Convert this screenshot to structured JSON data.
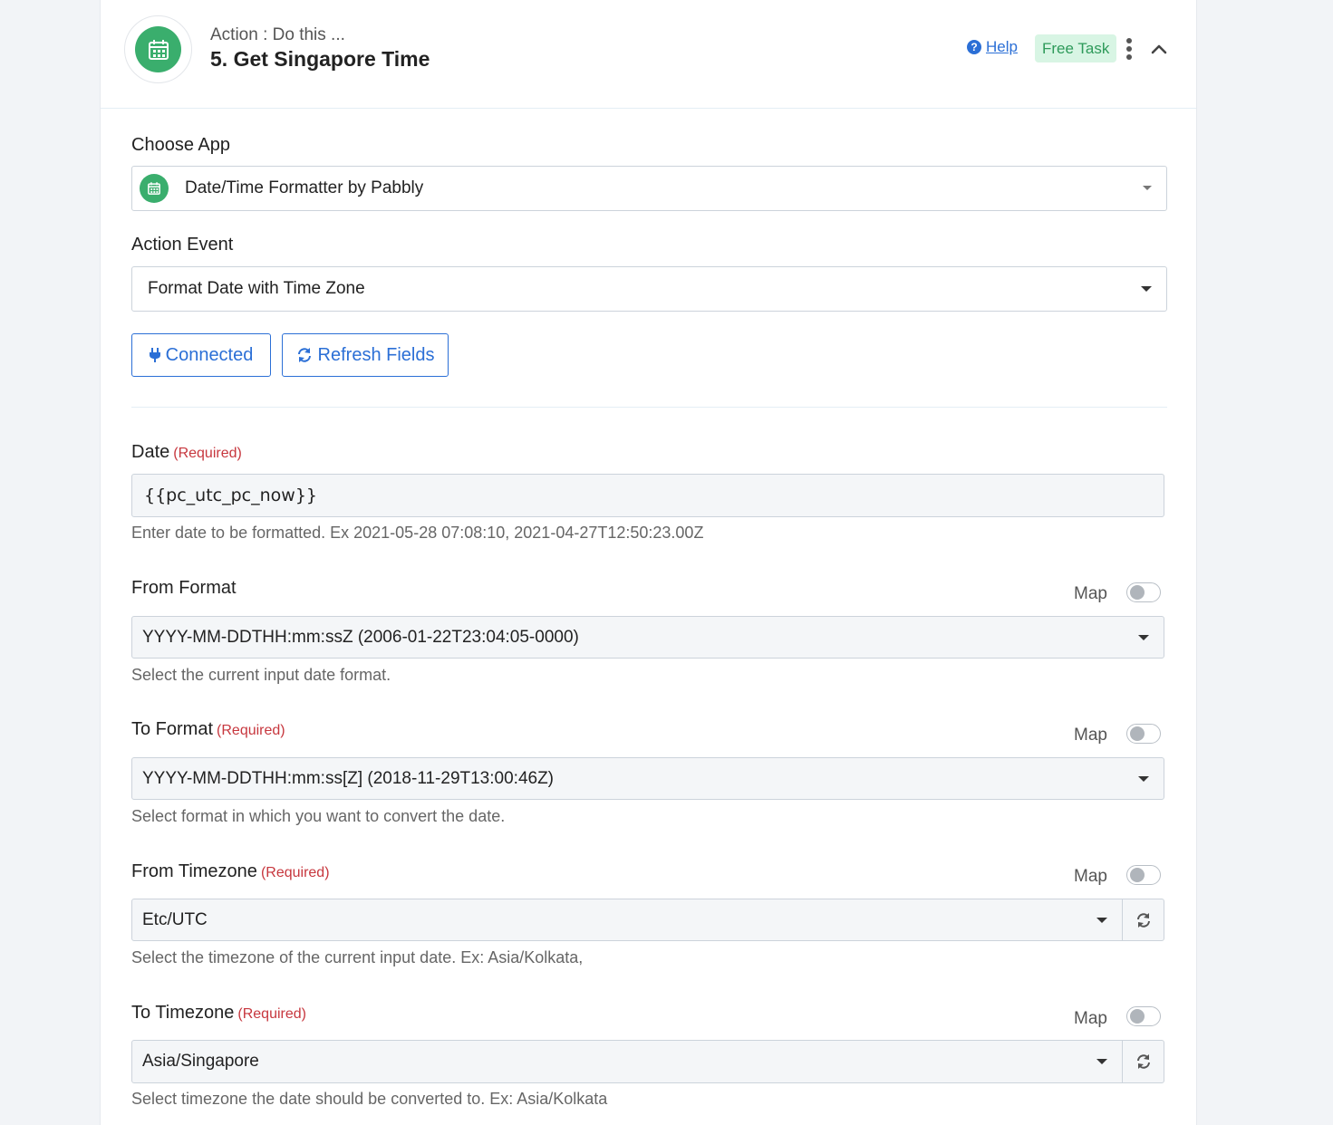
{
  "header": {
    "subtitle": "Action : Do this ...",
    "title": "5. Get Singapore Time",
    "help_label": "Help",
    "free_task_label": "Free Task"
  },
  "choose_app": {
    "label": "Choose App",
    "value": "Date/Time Formatter by Pabbly"
  },
  "action_event": {
    "label": "Action Event",
    "value": "Format Date with Time Zone"
  },
  "buttons": {
    "connected": "Connected",
    "refresh_fields": "Refresh Fields"
  },
  "fields": {
    "date": {
      "label": "Date",
      "required": "(Required)",
      "value": "{{pc_utc_pc_now}}",
      "hint": "Enter date to be formatted. Ex 2021-05-28 07:08:10, 2021-04-27T12:50:23.00Z"
    },
    "from_format": {
      "label": "From Format",
      "map_label": "Map",
      "value": "YYYY-MM-DDTHH:mm:ssZ (2006-01-22T23:04:05-0000)",
      "hint": "Select the current input date format."
    },
    "to_format": {
      "label": "To Format",
      "required": "(Required)",
      "map_label": "Map",
      "value": "YYYY-MM-DDTHH:mm:ss[Z] (2018-11-29T13:00:46Z)",
      "hint": "Select format in which you want to convert the date."
    },
    "from_timezone": {
      "label": "From Timezone",
      "required": "(Required)",
      "map_label": "Map",
      "value": "Etc/UTC",
      "hint": "Select the timezone of the current input date. Ex: Asia/Kolkata,"
    },
    "to_timezone": {
      "label": "To Timezone",
      "required": "(Required)",
      "map_label": "Map",
      "value": "Asia/Singapore",
      "hint": "Select timezone the date should be converted to. Ex: Asia/Kolkata"
    }
  },
  "colors": {
    "accent": "#2b6fd6",
    "brand_green": "#3aae6d",
    "required": "#c7373e"
  }
}
